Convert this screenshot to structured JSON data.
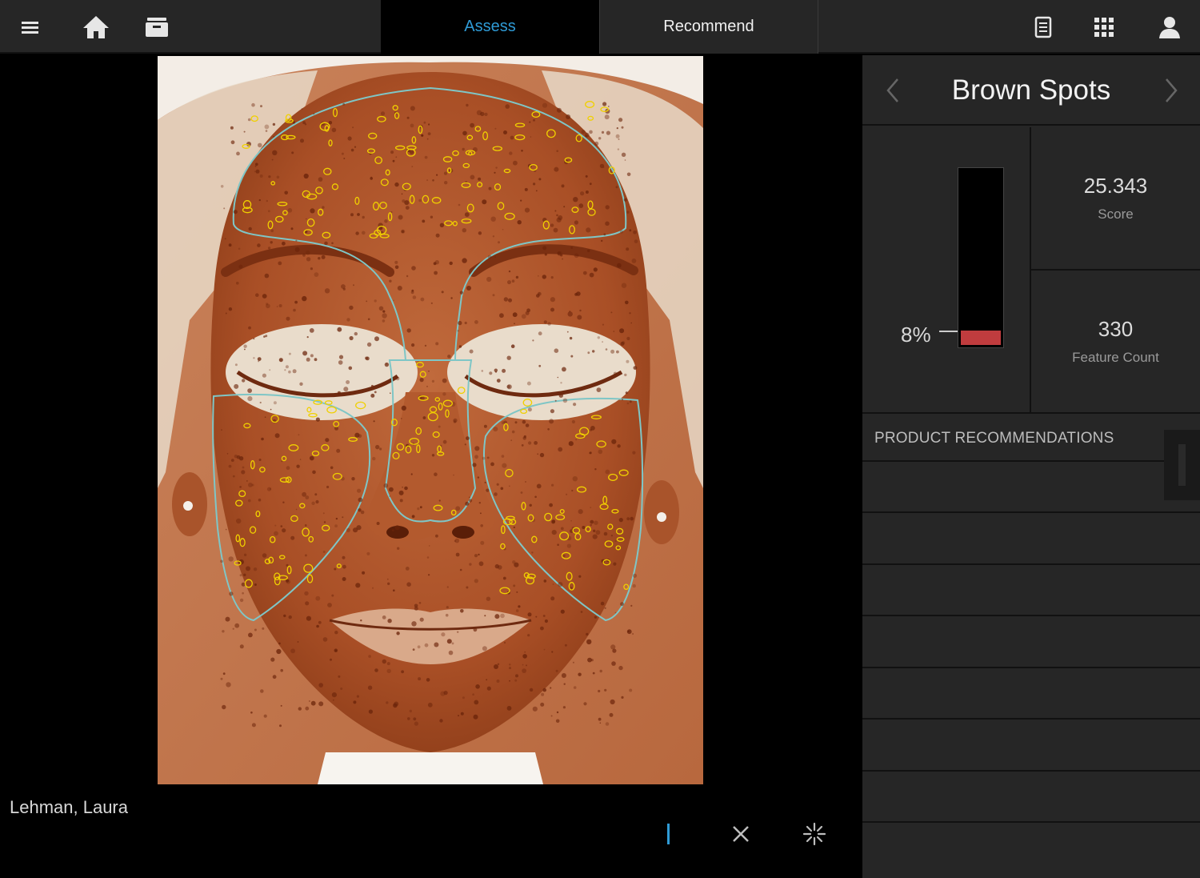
{
  "topbar": {
    "icons": [
      "menu-icon",
      "home-icon",
      "cabinet-icon",
      "report-icon",
      "apps-grid-icon",
      "user-icon"
    ],
    "tabs": [
      {
        "label": "Assess",
        "active": true
      },
      {
        "label": "Recommend",
        "active": false
      }
    ]
  },
  "colors": {
    "accent": "#2f9bd6",
    "gauge_fill": "#c03c3e",
    "panel": "#262626",
    "skin_tone": "#b0552a",
    "spot_outline": "#f0d000",
    "zone_outline": "#7fc6c6"
  },
  "image": {
    "name": "Face photo - brown spots analysis"
  },
  "patient": {
    "name": "Lehman, Laura"
  },
  "bottom_tools": [
    "line-cursor-icon",
    "close-icon",
    "sparkle-icon"
  ],
  "metric": {
    "title": "Brown Spots",
    "percentile_label": "8%",
    "percentile": 0.08,
    "score_value": "25.343",
    "score_label": "Score",
    "count_value": "330",
    "count_label": "Feature Count"
  },
  "products": {
    "title": "PRODUCT RECOMMENDATIONS",
    "rows": 7
  }
}
